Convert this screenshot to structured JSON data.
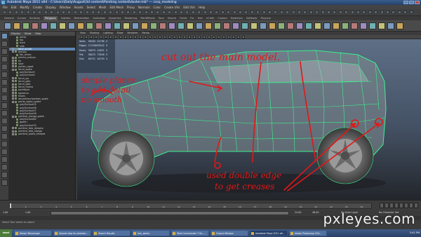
{
  "window": {
    "title": "Autodesk Maya 2011 x64 - C:\\Users\\Daily\\August\\3d content\\Painting contest\\duster.mb* --- corp_modeling"
  },
  "menubar": [
    "File",
    "Edit",
    "Modify",
    "Create",
    "Display",
    "Window",
    "Assets",
    "Select",
    "Mesh",
    "Edit Mesh",
    "Proxy",
    "Normals",
    "Color",
    "Create UVs",
    "Edit UVs",
    "Help"
  ],
  "shelf_tabs": [
    "General",
    "Curves",
    "Surfaces",
    "Polygons",
    "Subdivs",
    "Deformation",
    "Animation",
    "Dynamics",
    "Rendering",
    "PaintEffects",
    "Toon",
    "Muscle",
    "Fluids",
    "Fur",
    "Hair",
    "nCloth",
    "Custom",
    "fluidchars",
    "Softbody",
    "Physical"
  ],
  "shelf_active_tab": "Polygons",
  "outliner": {
    "menu": [
      "Display",
      "Show",
      "Help"
    ],
    "items": [
      {
        "label": "persp",
        "selected": false,
        "expand": false
      },
      {
        "label": "top",
        "selected": false,
        "expand": false
      },
      {
        "label": "front",
        "selected": false,
        "expand": false
      },
      {
        "label": "side",
        "selected": false,
        "expand": false
      },
      {
        "label": "total_duster",
        "selected": true,
        "expand": true
      },
      {
        "label": "groupp",
        "selected": false,
        "expand": true
      },
      {
        "label": "fon_oriasc",
        "selected": false,
        "expand": false
      },
      {
        "label": "pirinho_malsus",
        "selected": false,
        "expand": true
      },
      {
        "label": "far",
        "selected": false,
        "expand": true
      },
      {
        "label": "Spot",
        "selected": false,
        "expand": true
      },
      {
        "label": "partes_capot",
        "selected": false,
        "expand": true
      },
      {
        "label": "faruri_spate",
        "selected": false,
        "expand": true
      },
      {
        "label": "polySurface3",
        "selected": false,
        "expand": false
      },
      {
        "label": "polySurface4",
        "selected": false,
        "expand": false
      },
      {
        "label": "faruri_jos",
        "selected": false,
        "expand": true
      },
      {
        "label": "faruri_glas",
        "selected": false,
        "expand": true
      },
      {
        "label": "faruri_glas",
        "selected": false,
        "expand": true
      },
      {
        "label": "faruri_mama",
        "selected": false,
        "expand": true
      },
      {
        "label": "pachbaye",
        "selected": false,
        "expand": true
      },
      {
        "label": "eplodcca",
        "selected": false,
        "expand": true
      },
      {
        "label": "Shoes",
        "selected": false,
        "expand": true
      },
      {
        "label": "decoratisumperbes_spate",
        "selected": false,
        "expand": true
      },
      {
        "label": "partie_spate_spatie",
        "selected": false,
        "expand": true
      },
      {
        "label": "polySurface55",
        "selected": false,
        "expand": false
      },
      {
        "label": "polySurface56",
        "selected": false,
        "expand": false
      },
      {
        "label": "polySurface57",
        "selected": false,
        "expand": false
      },
      {
        "label": "polySurface58",
        "selected": false,
        "expand": false
      },
      {
        "label": "portiera_stanga_spate",
        "selected": false,
        "expand": true
      },
      {
        "label": "polySurface62",
        "selected": false,
        "expand": false
      },
      {
        "label": "gpaltri",
        "selected": false,
        "expand": false
      },
      {
        "label": "polySurface70",
        "selected": false,
        "expand": false
      },
      {
        "label": "portiera_fata_dreapta",
        "selected": false,
        "expand": true
      },
      {
        "label": "portiera_fata_stanga",
        "selected": false,
        "expand": true
      },
      {
        "label": "portiera_spate_dreapta",
        "selected": false,
        "expand": true
      }
    ]
  },
  "viewport": {
    "menu": [
      "View",
      "Shading",
      "Lighting",
      "Show",
      "Renderer",
      "Panels"
    ],
    "hud": {
      "rows": [
        {
          "label": "Verts:",
          "a": "56300",
          "b": "41798",
          "c": "0"
        },
        {
          "label": "Edges:",
          "a": "113348",
          "b": "83542",
          "c": "0"
        },
        {
          "label": "Faces:",
          "a": "56979",
          "b": "41851",
          "c": "0"
        },
        {
          "label": "Tris:",
          "a": "98223",
          "b": "73928",
          "c": "0"
        },
        {
          "label": "UVs:",
          "a": "60721",
          "b": "44793",
          "c": "0"
        }
      ]
    },
    "annotations": {
      "top": "cut out the main model.",
      "left_line1": "simple planes",
      "left_line2": "to add detail",
      "left_line3": "no smooth",
      "bottom_line1": "used double edge",
      "bottom_line2": "to get creases"
    }
  },
  "timeslider": {
    "start": "1.00",
    "end": "24.00",
    "end2": "48.00",
    "current": "1.00",
    "range_start": "1.00",
    "ticks": [
      "1",
      "2",
      "3",
      "4",
      "5",
      "6",
      "7",
      "8",
      "9",
      "10",
      "11",
      "12",
      "13",
      "14",
      "15",
      "16",
      "17",
      "18",
      "19",
      "20",
      "21",
      "22",
      "23",
      "24"
    ],
    "anim_layer": "No Anim Layer",
    "char_set": "No Character Set"
  },
  "helpline": "Select Tool: select an object",
  "taskbar": {
    "start_label": "start",
    "items": [
      {
        "label": "Yahoo! Messenger",
        "active": false
      },
      {
        "label": "Upload step for photosh...",
        "active": false
      },
      {
        "label": "Search Results",
        "active": false
      },
      {
        "label": "iron_works",
        "active": false
      },
      {
        "label": "Total Commander 7.5a -...",
        "active": false
      },
      {
        "label": "Output Window",
        "active": false
      },
      {
        "label": "Autodesk Maya 2011 x6...",
        "active": true
      },
      {
        "label": "Adobe Photoshop CS4...",
        "active": false
      }
    ],
    "clock": "3:42 PM"
  },
  "watermark": "pxleyes.com",
  "colors": {
    "wireframe": "#3cf08c",
    "annotation": "#e01818",
    "selection": "#5f87b5"
  }
}
